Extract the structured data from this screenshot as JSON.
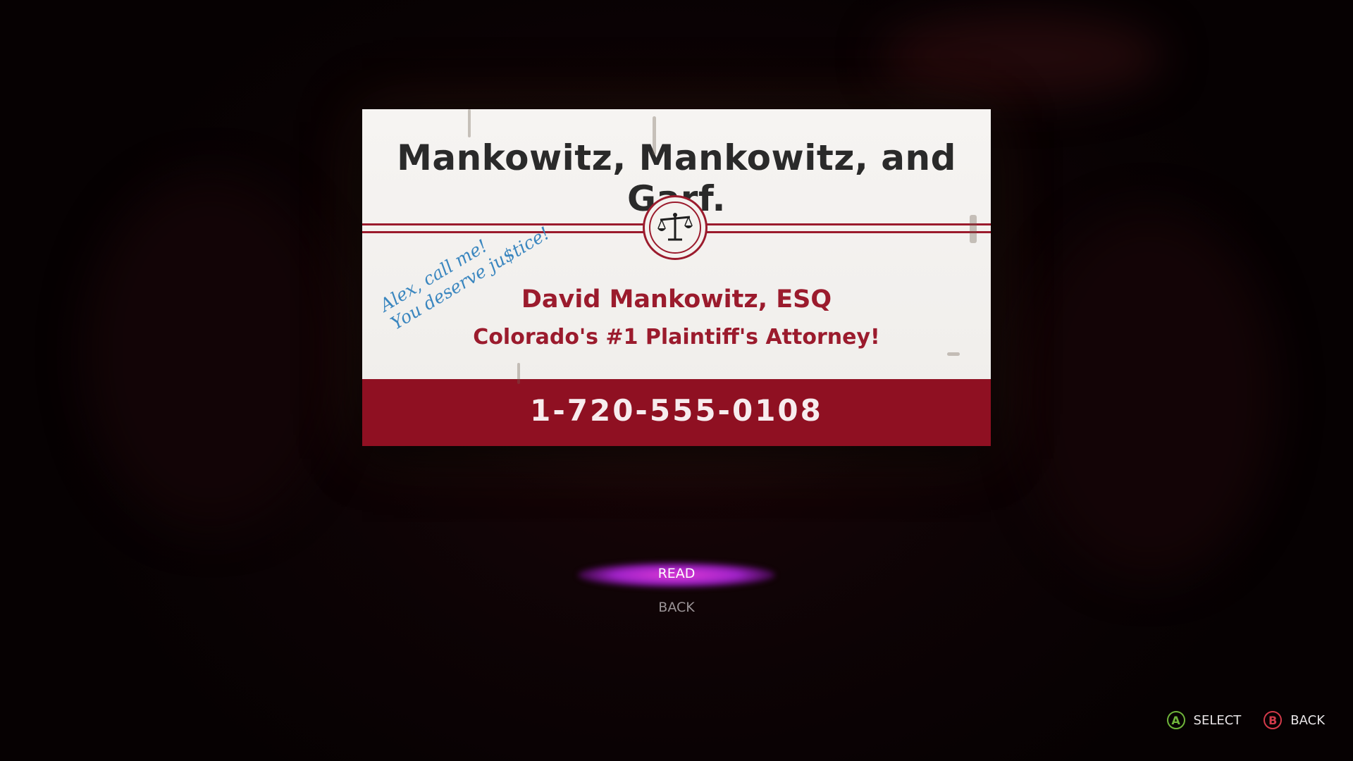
{
  "card": {
    "firm_name": "Mankowitz, Mankowitz, and Garf.",
    "emblem_icon": "scales-of-justice-icon",
    "attorney_name": "David Mankowitz, ESQ",
    "tagline": "Colorado's #1 Plaintiff's Attorney!",
    "handwritten_note": {
      "line1": "Alex, call me!",
      "line2": "You deserve ju$tice!"
    },
    "phone": "1-720-555-0108",
    "colors": {
      "accent": "#9b1b2d",
      "band": "#8f1022",
      "handwriting": "#3a86bf"
    }
  },
  "menu": {
    "items": [
      {
        "label": "READ",
        "selected": true
      },
      {
        "label": "BACK",
        "selected": false
      }
    ],
    "highlight_color": "#d93ad6"
  },
  "hints": [
    {
      "button": "A",
      "label": "SELECT",
      "color": "#6fb43a"
    },
    {
      "button": "B",
      "label": "BACK",
      "color": "#d33a4a"
    }
  ]
}
